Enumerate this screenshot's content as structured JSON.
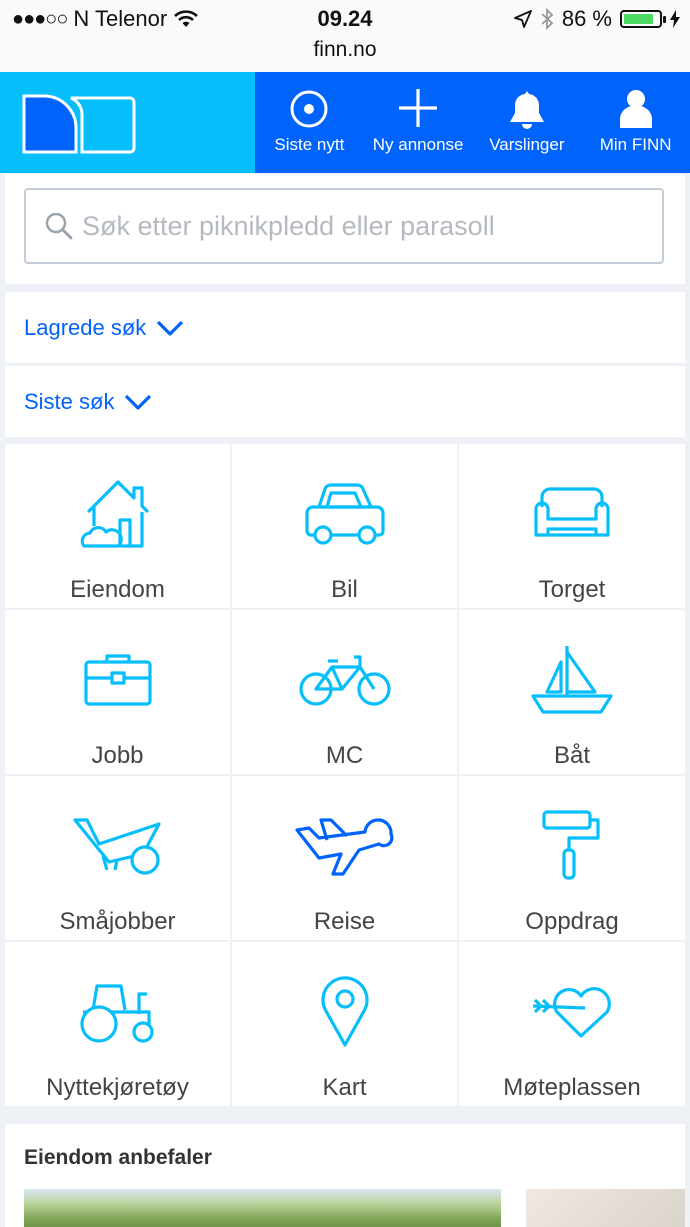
{
  "status_bar": {
    "signal_dots": "●●●○○",
    "carrier": "N Telenor",
    "time": "09.24",
    "url": "finn.no",
    "battery_text": "86 %",
    "battery_level": 0.86
  },
  "header": {
    "nav": [
      {
        "label": "Siste nytt",
        "icon": "target-icon"
      },
      {
        "label": "Ny annonse",
        "icon": "plus-icon"
      },
      {
        "label": "Varslinger",
        "icon": "bell-icon"
      },
      {
        "label": "Min FINN",
        "icon": "user-icon"
      }
    ]
  },
  "search": {
    "placeholder": "Søk etter piknikpledd eller parasoll"
  },
  "saved_searches": {
    "label": "Lagrede søk"
  },
  "recent_searches": {
    "label": "Siste søk"
  },
  "categories": [
    {
      "label": "Eiendom",
      "icon": "house-icon"
    },
    {
      "label": "Bil",
      "icon": "car-icon"
    },
    {
      "label": "Torget",
      "icon": "sofa-icon"
    },
    {
      "label": "Jobb",
      "icon": "briefcase-icon"
    },
    {
      "label": "MC",
      "icon": "bicycle-icon"
    },
    {
      "label": "Båt",
      "icon": "sailboat-icon"
    },
    {
      "label": "Småjobber",
      "icon": "wheelbarrow-icon"
    },
    {
      "label": "Reise",
      "icon": "airplane-icon"
    },
    {
      "label": "Oppdrag",
      "icon": "paint-roller-icon"
    },
    {
      "label": "Nyttekjøretøy",
      "icon": "tractor-icon"
    },
    {
      "label": "Kart",
      "icon": "map-pin-icon"
    },
    {
      "label": "Møteplassen",
      "icon": "heart-arrow-icon"
    }
  ],
  "recommendations": {
    "title": "Eiendom anbefaler"
  },
  "colors": {
    "brand_blue": "#0063fb",
    "logo_cyan": "#06befb",
    "icon_cyan": "#06befb"
  }
}
